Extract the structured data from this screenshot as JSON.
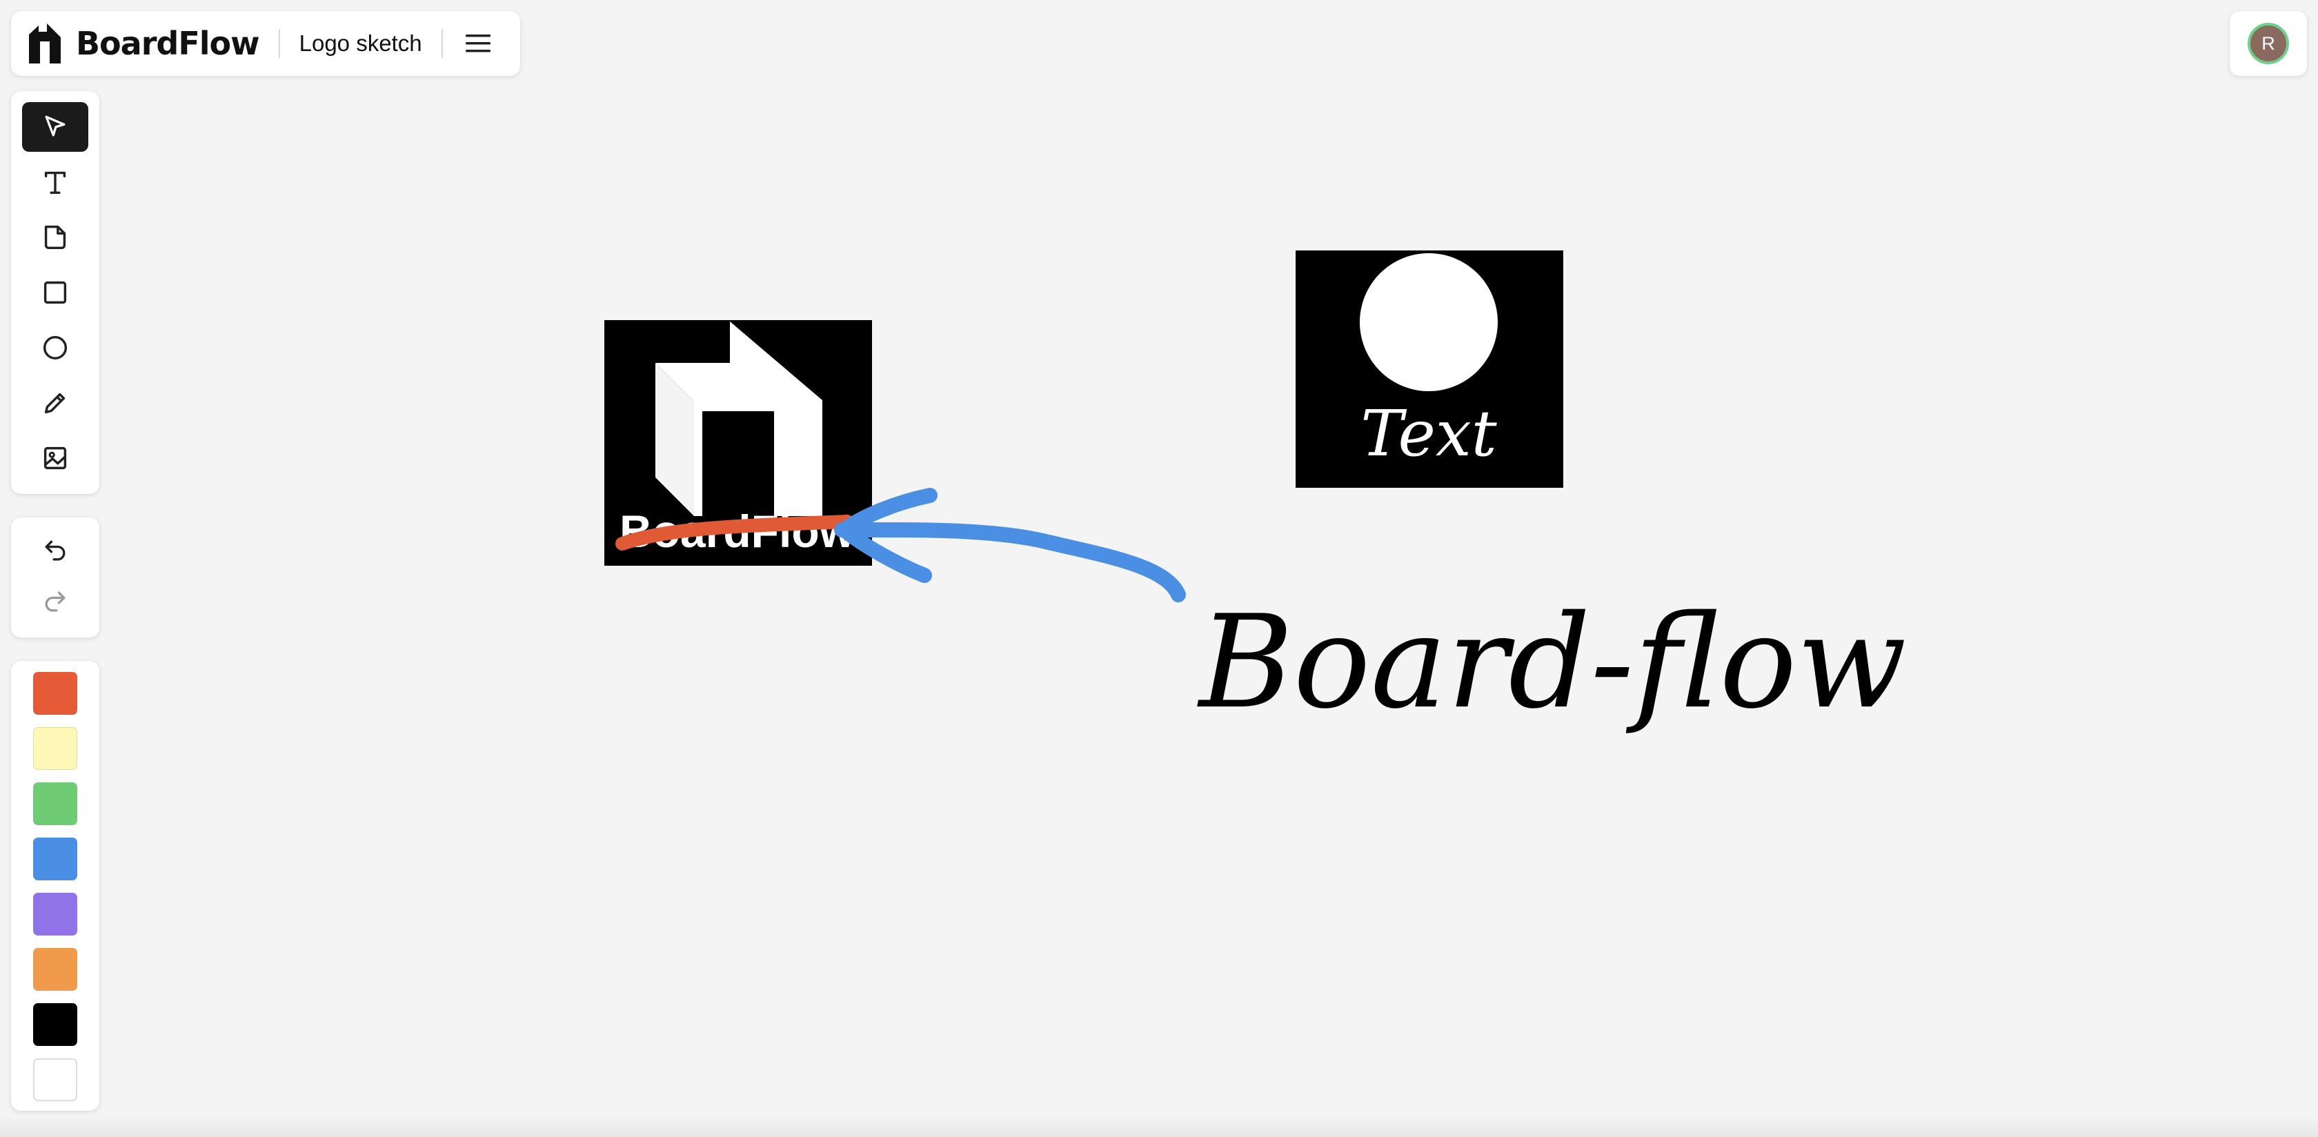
{
  "app": {
    "brand": "BoardFlow",
    "document_title": "Logo sketch"
  },
  "user": {
    "avatar_initial": "R"
  },
  "toolbar": {
    "tools": [
      {
        "name": "select",
        "icon": "cursor-arrow-icon",
        "active": true
      },
      {
        "name": "text",
        "icon": "text-icon",
        "active": false
      },
      {
        "name": "sticky-note",
        "icon": "sticky-note-icon",
        "active": false
      },
      {
        "name": "rectangle",
        "icon": "square-icon",
        "active": false
      },
      {
        "name": "ellipse",
        "icon": "circle-icon",
        "active": false
      },
      {
        "name": "pen",
        "icon": "pencil-icon",
        "active": false
      },
      {
        "name": "image",
        "icon": "image-icon",
        "active": false
      }
    ],
    "history": [
      {
        "name": "undo",
        "icon": "undo-icon",
        "enabled": true
      },
      {
        "name": "redo",
        "icon": "redo-icon",
        "enabled": false
      }
    ],
    "colors": [
      "#e55a37",
      "#fff7b8",
      "#6fcb74",
      "#4a8fe3",
      "#9173e8",
      "#f09a4c",
      "#000000",
      "#ffffff"
    ]
  },
  "board": {
    "logo_card_text": "BoardFlow",
    "text_card_label": "Text",
    "handwritten_text": "Board-flow",
    "annotation_colors": {
      "strike": "#e05a36",
      "arrow": "#4a8fe3"
    }
  }
}
